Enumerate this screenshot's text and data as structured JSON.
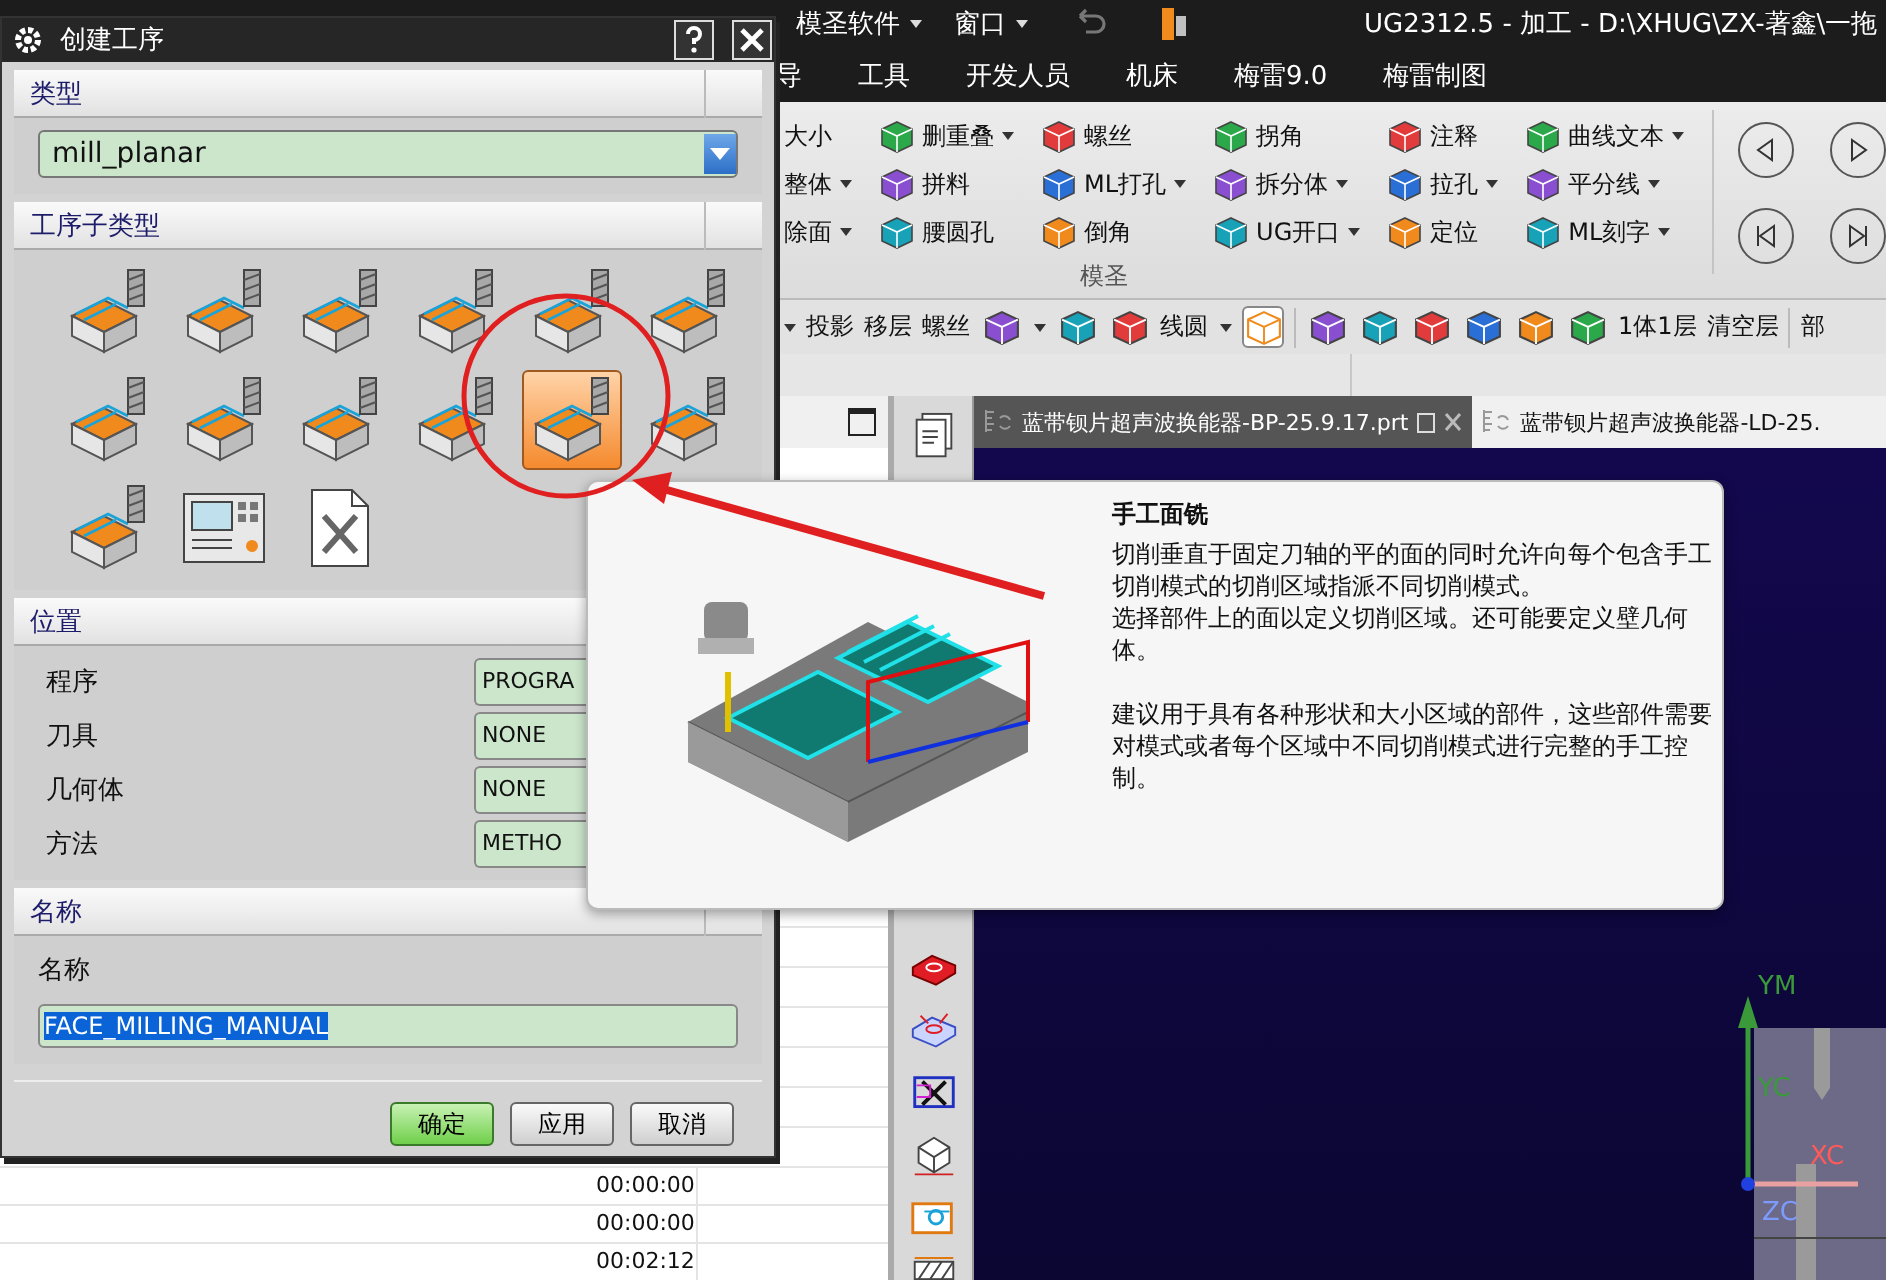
{
  "title_bar": {
    "menus": [
      {
        "label": "模圣软件",
        "dropdown": true
      },
      {
        "label": "窗口",
        "dropdown": true
      }
    ],
    "title": "UG2312.5 - 加工 - D:\\XHUG\\ZX-著鑫\\一拖"
  },
  "ribbon_tabs": [
    {
      "label": "导",
      "selected": false
    },
    {
      "label": "工具",
      "selected": false
    },
    {
      "label": "开发人员",
      "selected": false
    },
    {
      "label": "机床",
      "selected": false
    },
    {
      "label": "梅雷9.0",
      "selected": false
    },
    {
      "label": "梅雷制图",
      "selected": false
    }
  ],
  "ribbon": {
    "columns": [
      {
        "items": [
          {
            "label": "大小",
            "dropdown": false,
            "icon": false
          },
          {
            "label": "整体",
            "dropdown": true,
            "icon": false
          },
          {
            "label": "除面",
            "dropdown": true,
            "icon": false
          }
        ]
      },
      {
        "items": [
          {
            "label": "删重叠",
            "dropdown": true,
            "icon": true
          },
          {
            "label": "拼料",
            "dropdown": false,
            "icon": true
          },
          {
            "label": "腰圆孔",
            "dropdown": false,
            "icon": true
          }
        ]
      },
      {
        "items": [
          {
            "label": "螺丝",
            "dropdown": false,
            "icon": true
          },
          {
            "label": "ML打孔",
            "dropdown": true,
            "icon": true
          },
          {
            "label": "倒角",
            "dropdown": false,
            "icon": true
          }
        ]
      },
      {
        "items": [
          {
            "label": "拐角",
            "dropdown": false,
            "icon": true
          },
          {
            "label": "拆分体",
            "dropdown": true,
            "icon": true
          },
          {
            "label": "UG开口",
            "dropdown": true,
            "icon": true
          }
        ]
      },
      {
        "items": [
          {
            "label": "注释",
            "dropdown": false,
            "icon": true
          },
          {
            "label": "拉孔",
            "dropdown": true,
            "icon": true
          },
          {
            "label": "定位",
            "dropdown": false,
            "icon": true
          }
        ]
      },
      {
        "items": [
          {
            "label": "曲线文本",
            "dropdown": true,
            "icon": true
          },
          {
            "label": "平分线",
            "dropdown": true,
            "icon": true
          },
          {
            "label": "ML刻字",
            "dropdown": true,
            "icon": true
          }
        ]
      }
    ],
    "group_label": "模圣"
  },
  "toolbar": {
    "items": [
      {
        "kind": "caret"
      },
      {
        "kind": "text",
        "label": "投影"
      },
      {
        "kind": "text",
        "label": "移层"
      },
      {
        "kind": "text",
        "label": "螺丝"
      },
      {
        "kind": "icon",
        "pressed": false,
        "dropdown": true
      },
      {
        "kind": "icon",
        "pressed": false,
        "dropdown": false
      },
      {
        "kind": "icon",
        "pressed": false,
        "dropdown": false
      },
      {
        "kind": "text",
        "label": "线圆",
        "dropdown": true
      },
      {
        "kind": "icon",
        "pressed": true,
        "dropdown": false
      },
      {
        "kind": "separator"
      },
      {
        "kind": "icon",
        "pressed": false,
        "dropdown": false
      },
      {
        "kind": "icon",
        "pressed": false,
        "dropdown": false
      },
      {
        "kind": "icon",
        "pressed": false,
        "dropdown": false
      },
      {
        "kind": "icon",
        "pressed": false,
        "dropdown": false
      },
      {
        "kind": "icon",
        "pressed": false,
        "dropdown": false
      },
      {
        "kind": "icon",
        "pressed": false,
        "dropdown": false
      },
      {
        "kind": "text",
        "label": "1体1层"
      },
      {
        "kind": "text",
        "label": "清空层"
      },
      {
        "kind": "separator"
      },
      {
        "kind": "text",
        "label": "部"
      }
    ]
  },
  "left_panel": {
    "times": [
      "00:00:00",
      "00:00:00",
      "00:02:12"
    ]
  },
  "graphics": {
    "tabs": [
      {
        "label": "蓝带钡片超声波换能器-BP-25.9.17.prt",
        "selected": true
      },
      {
        "label": "蓝带钡片超声波换能器-LD-25.",
        "selected": false
      }
    ],
    "axis_labels": {
      "ym": "YM",
      "yc": "YC",
      "xc": "XC",
      "zc": "ZC"
    }
  },
  "dialog": {
    "title": "创建工序",
    "type_section": {
      "title": "类型",
      "value": "mill_planar"
    },
    "subtype_section": {
      "title": "工序子类型",
      "items": [
        {
          "kind": "block",
          "selected": false
        },
        {
          "kind": "block",
          "selected": false
        },
        {
          "kind": "block",
          "selected": false
        },
        {
          "kind": "block",
          "selected": false
        },
        {
          "kind": "block",
          "selected": false
        },
        {
          "kind": "block",
          "selected": false
        },
        {
          "kind": "block",
          "selected": false
        },
        {
          "kind": "block",
          "selected": false
        },
        {
          "kind": "block",
          "selected": false
        },
        {
          "kind": "block",
          "selected": false
        },
        {
          "kind": "block",
          "selected": true
        },
        {
          "kind": "block",
          "selected": false
        },
        {
          "kind": "block",
          "selected": false
        },
        {
          "kind": "screen",
          "selected": false
        },
        {
          "kind": "document",
          "selected": false
        }
      ]
    },
    "location_section": {
      "title": "位置",
      "rows": [
        {
          "label": "程序",
          "value": "PROGRA"
        },
        {
          "label": "刀具",
          "value": "NONE"
        },
        {
          "label": "几何体",
          "value": "NONE"
        },
        {
          "label": "方法",
          "value": "METHO"
        }
      ]
    },
    "name_section": {
      "title": "名称",
      "label": "名称",
      "value": "FACE_MILLING_MANUAL"
    },
    "buttons": [
      {
        "label": "确定",
        "default": true
      },
      {
        "label": "应用",
        "default": false
      },
      {
        "label": "取消",
        "default": false
      }
    ]
  },
  "tooltip": {
    "title": "手工面铣",
    "text_blocks": [
      [
        "切削垂直于固定刀轴的平的面的同时允许向每个包含手工切削模式的切削区域指派不同切削模式。",
        "选择部件上的面以定义切削区域。还可能要定义壁几何体。"
      ],
      [
        "建议用于具有各种形状和大小区域的部件，这些部件需要对模式或者每个区域中不同切削模式进行完整的手工控制。"
      ]
    ]
  }
}
